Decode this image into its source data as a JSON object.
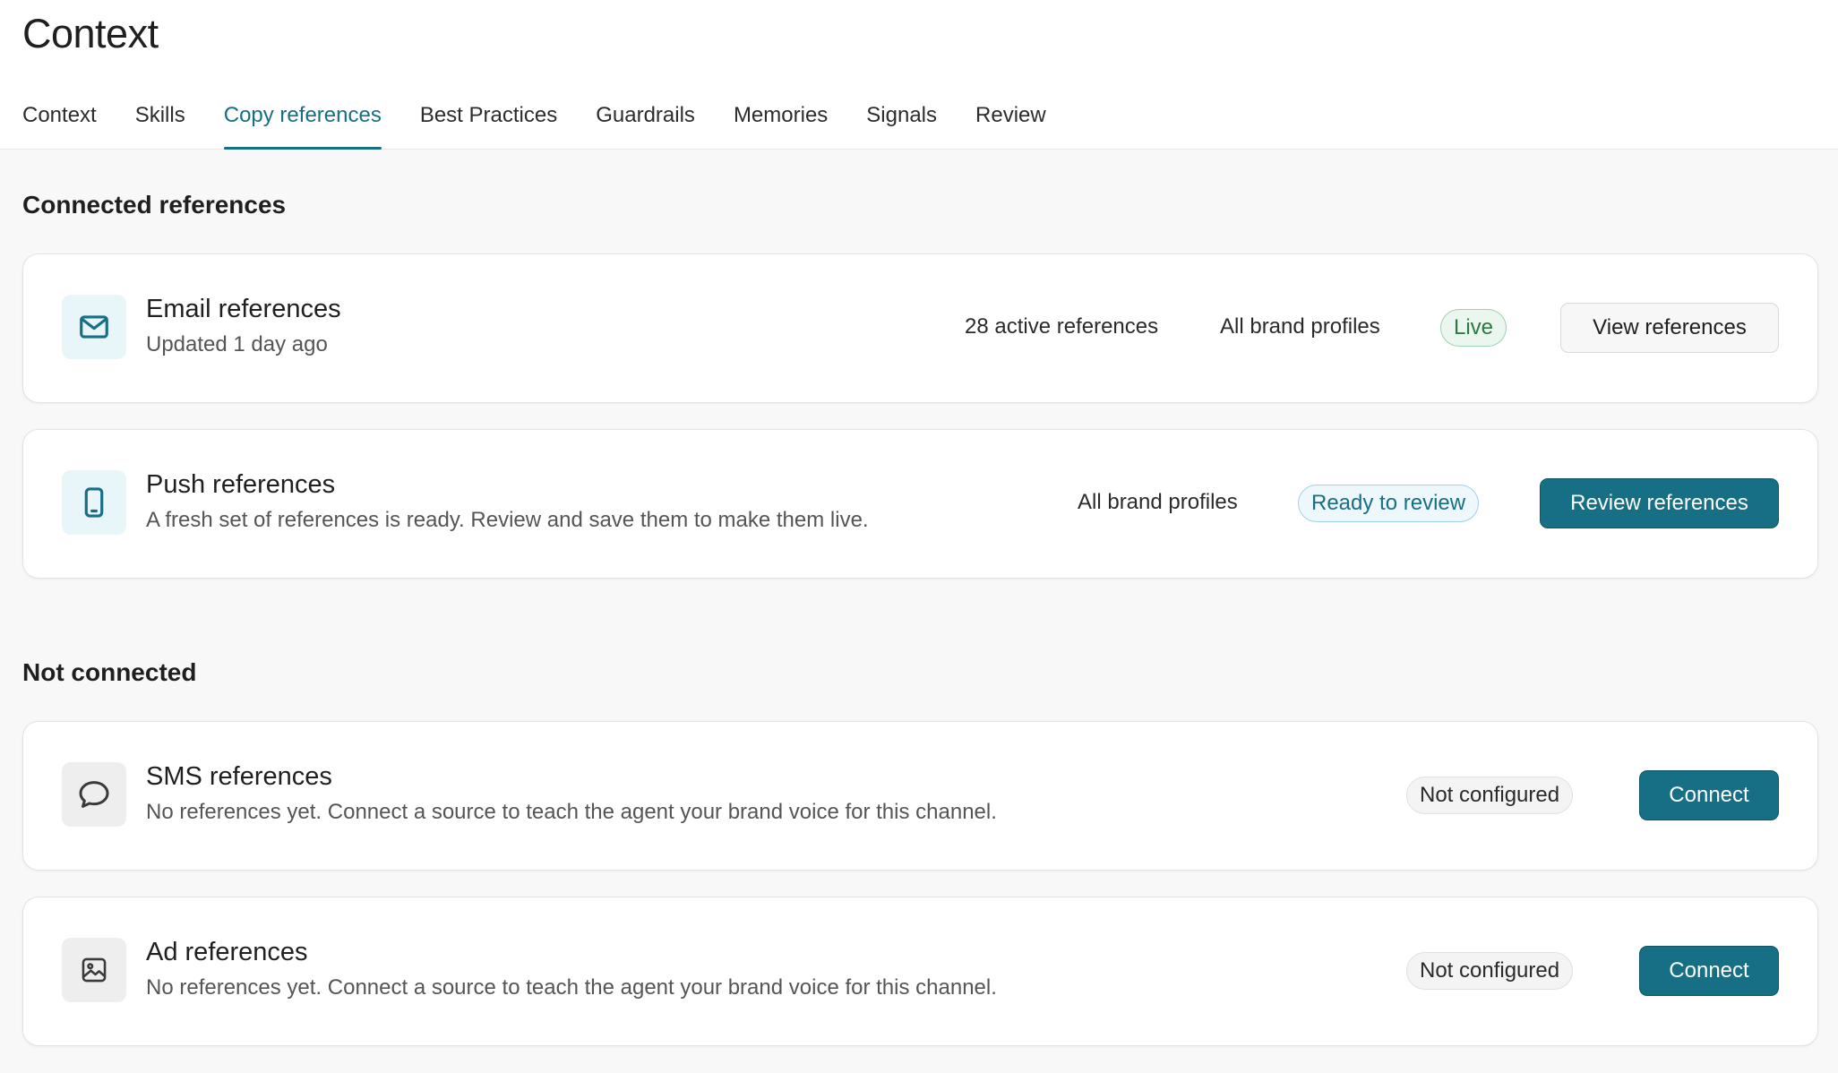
{
  "page": {
    "title": "Context"
  },
  "tabs": [
    {
      "label": "Context"
    },
    {
      "label": "Skills"
    },
    {
      "label": "Copy references",
      "active": true
    },
    {
      "label": "Best Practices"
    },
    {
      "label": "Guardrails"
    },
    {
      "label": "Memories"
    },
    {
      "label": "Signals"
    },
    {
      "label": "Review"
    }
  ],
  "connected": {
    "title": "Connected references",
    "cards": [
      {
        "icon": "envelope-icon",
        "title": "Email references",
        "subtitle": "Updated 1 day ago",
        "count": "28 active references",
        "profiles": "All brand profiles",
        "status": "Live",
        "action": "View references"
      },
      {
        "icon": "phone-icon",
        "title": "Push references",
        "subtitle": "A fresh set of references is ready. Review and save them to make them live.",
        "profiles": "All brand profiles",
        "status": "Ready to review",
        "action": "Review references"
      }
    ]
  },
  "not_connected": {
    "title": "Not connected",
    "cards": [
      {
        "icon": "chat-bubble-icon",
        "title": "SMS references",
        "subtitle": "No references yet. Connect a source to teach the agent your brand voice for this channel.",
        "status": "Not configured",
        "action": "Connect"
      },
      {
        "icon": "image-ad-icon",
        "title": "Ad references",
        "subtitle": "No references yet. Connect a source to teach the agent your brand voice for this channel.",
        "status": "Not configured",
        "action": "Connect"
      }
    ]
  },
  "colors": {
    "accent": "#166f84",
    "live_green": "#2a7a42",
    "background": "#f8f8f8"
  }
}
